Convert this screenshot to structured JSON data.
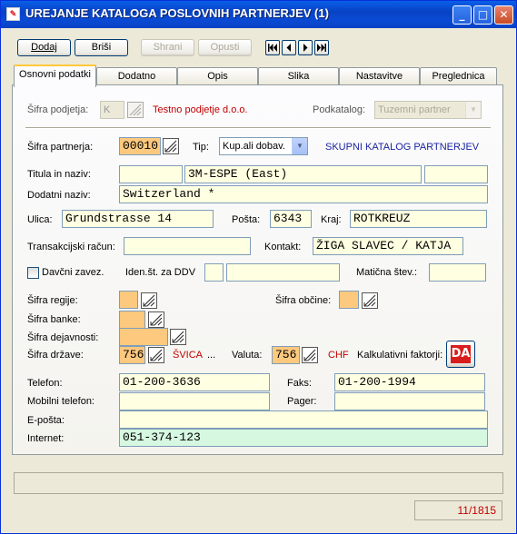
{
  "window": {
    "title": "UREJANJE KATALOGA POSLOVNIH PARTNERJEV (1)",
    "minimize": "_",
    "maximize": "□",
    "close": "✕"
  },
  "toolbar": {
    "add_label": "Dodaj",
    "delete_label": "Briši",
    "save_label": "Shrani",
    "cancel_label": "Opusti",
    "nav_first": "⏮",
    "nav_prev": "◀",
    "nav_next": "▶",
    "nav_last": "⏭"
  },
  "tabs": [
    {
      "label": "Osnovni podatki"
    },
    {
      "label": "Dodatno"
    },
    {
      "label": "Opis"
    },
    {
      "label": "Slika"
    },
    {
      "label": "Nastavitve"
    },
    {
      "label": "Preglednica"
    }
  ],
  "company": {
    "label": "Šifra podjetja:",
    "code": "K",
    "name": "Testno podjetje d.o.o.",
    "subcatalog_label": "Podkatalog:",
    "subcatalog_value": "Tuzemni partner"
  },
  "partner": {
    "code_label": "Šifra partnerja:",
    "code": "00010",
    "type_label": "Tip:",
    "type_value": "Kup.ali dobav.",
    "catalog_title": "SKUPNI KATALOG PARTNERJEV",
    "title_label": "Titula in naziv:",
    "title_value": "",
    "name_value": "3M-ESPE (East)",
    "name_extra": "",
    "extra_label": "Dodatni naziv:",
    "extra_value": "Switzerland *",
    "street_label": "Ulica:",
    "street_value": "Grundstrasse 14",
    "post_label": "Pošta:",
    "post_value": "6343",
    "city_label": "Kraj:",
    "city_value": "ROTKREUZ",
    "account_label": "Transakcijski račun:",
    "account_value": "",
    "contact_label": "Kontakt:",
    "contact_value": "ŽIGA SLAVEC / KATJA",
    "vat_label": "Davčni zavez.",
    "vat_id_label": "Iden.št. za DDV",
    "vat_prefix": "",
    "vat_id_value": "",
    "reg_label": "Matična štev.:",
    "reg_value": "",
    "region_label": "Šifra regije:",
    "municipality_label": "Šifra občine:",
    "bank_label": "Šifra banke:",
    "activity_label": "Šifra dejavnosti:",
    "country_label": "Šifra države:",
    "country_code": "756",
    "country_name": "ŠVICA",
    "country_more": "...",
    "currency_label": "Valuta:",
    "currency_code": "756",
    "currency_name": "CHF",
    "calc_label": "Kalkulativni faktorji:",
    "calc_button": "DA",
    "phone_label": "Telefon:",
    "phone_value": "01-200-3636",
    "fax_label": "Faks:",
    "fax_value": "01-200-1994",
    "mobile_label": "Mobilni telefon:",
    "mobile_value": "",
    "pager_label": "Pager:",
    "pager_value": "",
    "email_label": "E-pošta:",
    "email_value": "",
    "internet_label": "Internet:",
    "internet_value": "051-374-123"
  },
  "status": {
    "message": "",
    "record_counter": "11/1815"
  }
}
